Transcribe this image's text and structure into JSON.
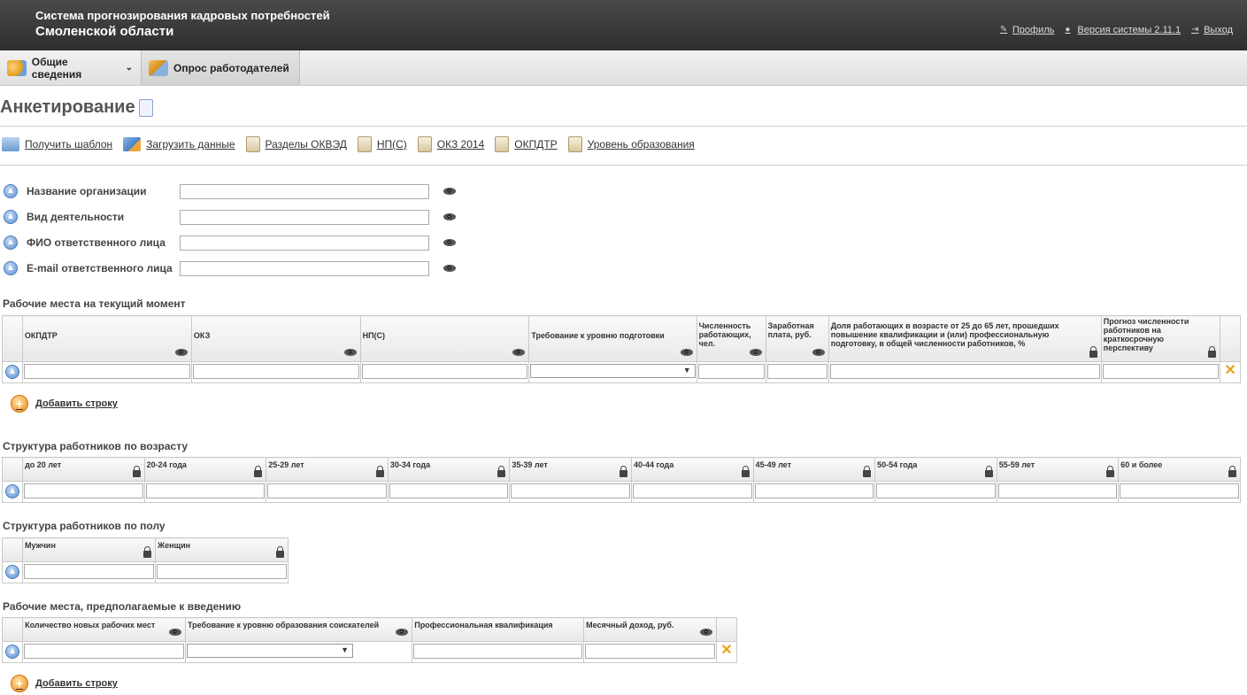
{
  "header": {
    "system_line1": "Система прогнозирования кадровых потребностей",
    "system_line2": "Смоленской области",
    "links": {
      "profile": "Профиль",
      "version": "Версия системы 2.11.1",
      "logout": "Выход"
    }
  },
  "menu": {
    "general": "Общие сведения",
    "survey": "Опрос работодателей"
  },
  "page": {
    "title": "Анкетирование"
  },
  "toolbar": {
    "get_template": "Получить шаблон",
    "upload_data": "Загрузить данные",
    "okved": "Разделы ОКВЭД",
    "nps": "НП(С)",
    "okz": "ОКЗ 2014",
    "okpdtr": "ОКПДТР",
    "edu_level": "Уровень образования"
  },
  "form": {
    "org_name": "Название организации",
    "activity": "Вид деятельности",
    "responsible_name": "ФИО ответственного лица",
    "responsible_email": "E-mail ответственного лица"
  },
  "sections": {
    "current_jobs": "Рабочие места на текущий момент",
    "age_structure": "Структура работников по возрасту",
    "gender_structure": "Структура работников по полу",
    "planned_jobs": "Рабочие места, предполагаемые к введению"
  },
  "current_table": {
    "headers": [
      "ОКПДТР",
      "ОКЗ",
      "НП(С)",
      "Требование к уровню подготовки",
      "Численность работающих, чел.",
      "Заработная плата, руб.",
      "Доля работающих в возрасте от 25 до 65 лет, прошедших повышение квалификации и (или) профессиональную подготовку, в общей численности работников, %",
      "Прогноз численности работников на краткосрочную перспективу"
    ]
  },
  "age_table": {
    "headers": [
      "до 20 лет",
      "20-24 года",
      "25-29 лет",
      "30-34 года",
      "35-39 лет",
      "40-44 года",
      "45-49 лет",
      "50-54 года",
      "55-59 лет",
      "60 и более"
    ]
  },
  "gender_table": {
    "headers": [
      "Мужчин",
      "Женщин"
    ]
  },
  "planned_table": {
    "headers": [
      "Количество новых рабочих мест",
      "Требование к уровню образования соискателей",
      "Профессиональная квалификация",
      "Месячный доход, руб."
    ]
  },
  "actions": {
    "add_row": "Добавить строку"
  }
}
